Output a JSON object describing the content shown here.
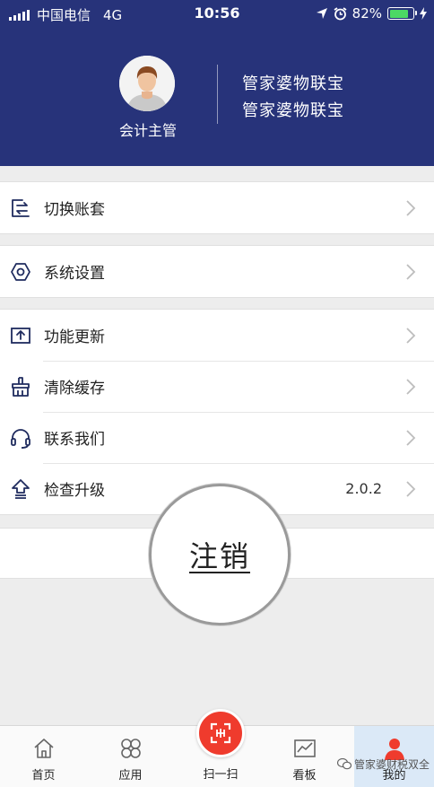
{
  "status_bar": {
    "carrier": "中国电信",
    "network": "4G",
    "time": "10:56",
    "battery": "82%",
    "battery_level": 0.82
  },
  "profile": {
    "role": "会计主管",
    "company_line1": "管家婆物联宝",
    "company_line2": "管家婆物联宝"
  },
  "menu": {
    "switch_account": "切换账套",
    "system_settings": "系统设置",
    "feature_update": "功能更新",
    "clear_cache": "清除缓存",
    "contact_us": "联系我们",
    "check_upgrade": "检查升级",
    "version": "2.0.2"
  },
  "logout": "注销",
  "tabbar": {
    "home": "首页",
    "apps": "应用",
    "scan": "扫一扫",
    "board": "看板",
    "mine": "我的"
  },
  "watermark": "管家婆财税双全",
  "colors": {
    "header_bg": "#27337a",
    "scan_button": "#ef3b2d",
    "active_tab_bg": "#dbe9f7"
  }
}
